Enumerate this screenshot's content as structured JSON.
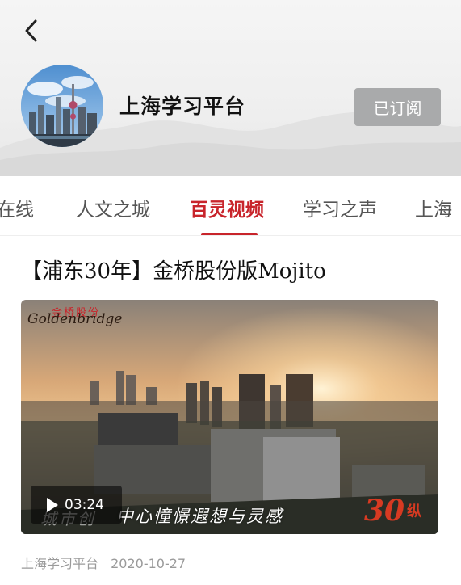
{
  "header": {
    "channel_name": "上海学习平台",
    "subscribe_label": "已订阅"
  },
  "tabs": [
    {
      "label": "在线",
      "active": false
    },
    {
      "label": "人文之城",
      "active": false
    },
    {
      "label": "百灵视频",
      "active": true
    },
    {
      "label": "学习之声",
      "active": false
    },
    {
      "label": "上海",
      "active": false
    }
  ],
  "article": {
    "title": "【浦东30年】金桥股份版Mojito",
    "video": {
      "logo_cn": "金桥股份",
      "logo_en": "Goldenbridge",
      "duration": "03:24",
      "subtitle_prefix": "城市创",
      "subtitle": "中心憧憬遐想与灵感",
      "badge_number": "30",
      "badge_suffix": "纵"
    },
    "source": "上海学习平台",
    "date": "2020-10-27"
  },
  "colors": {
    "accent": "#c8242b",
    "subscribe_bg": "#a9aaab"
  }
}
